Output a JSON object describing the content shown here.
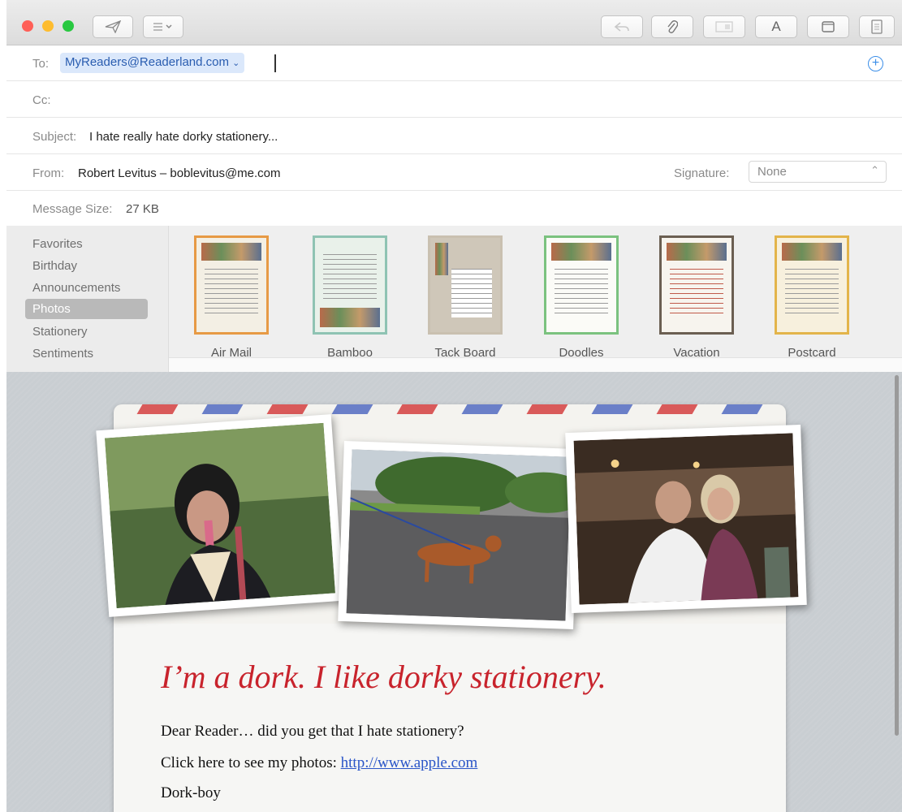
{
  "header": {
    "to_label": "To:",
    "to_value": "MyReaders@Readerland.com",
    "cc_label": "Cc:",
    "subject_label": "Subject:",
    "subject_value": "I hate really hate dorky stationery...",
    "from_label": "From:",
    "from_value": "Robert Levitus – boblevitus@me.com",
    "signature_label": "Signature:",
    "signature_value": "None",
    "size_label": "Message Size:",
    "size_value": "27 KB"
  },
  "toolbar": {
    "format_text_label": "A"
  },
  "categories": [
    "Favorites",
    "Birthday",
    "Announcements",
    "Photos",
    "Stationery",
    "Sentiments"
  ],
  "selected_category": "Photos",
  "templates": [
    {
      "name": "Air Mail",
      "border": "#e79a45"
    },
    {
      "name": "Bamboo",
      "border": "#8fc3b3"
    },
    {
      "name": "Tack Board",
      "border": "#c9c0b0"
    },
    {
      "name": "Doodles",
      "border": "#7bc27f"
    },
    {
      "name": "Vacation",
      "border": "#6b5f52"
    },
    {
      "name": "Postcard",
      "border": "#e3b44a"
    }
  ],
  "message": {
    "headline": "I’m a dork. I like dorky stationery.",
    "line1": "Dear Reader… did you get that I hate stationery?",
    "line2_prefix": "Click here to see my photos:",
    "link": "http://www.apple.com",
    "line3": "Dork-boy"
  },
  "colors": {
    "close": "#ff5f57",
    "minimize": "#febc2e",
    "zoom": "#28c840",
    "headline": "#c8232c",
    "stripe_red": "#d95a5a",
    "stripe_blue": "#6a7fc8"
  }
}
